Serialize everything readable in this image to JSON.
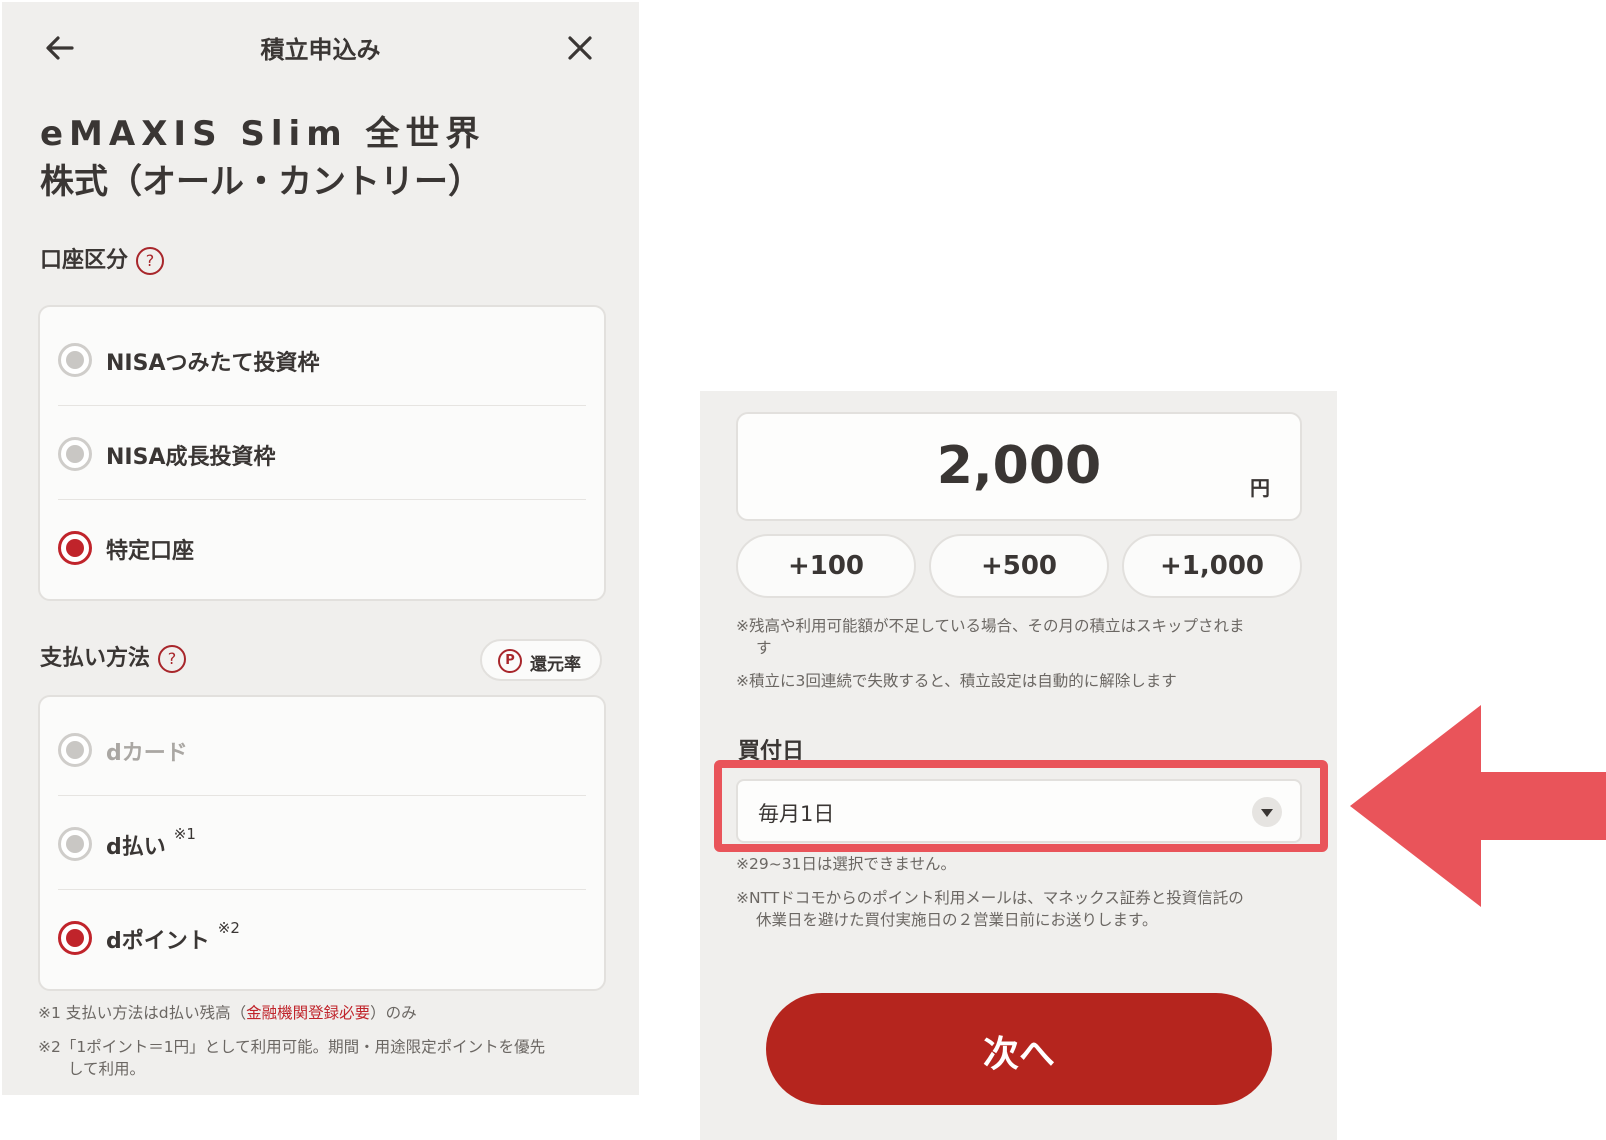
{
  "header": {
    "title": "積立申込み"
  },
  "fund": {
    "name_line1": "eMAXIS Slim 全世界",
    "name_line2": "株式（オール・カントリー）"
  },
  "account": {
    "label": "口座区分",
    "help": "?",
    "options": [
      {
        "label": "NISAつみたて投資枠",
        "selected": false
      },
      {
        "label": "NISA成長投資枠",
        "selected": false
      },
      {
        "label": "特定口座",
        "selected": true
      }
    ]
  },
  "payment": {
    "label": "支払い方法",
    "help": "?",
    "rate_badge": {
      "icon_text": "P",
      "label": "還元率"
    },
    "options": [
      {
        "label": "dカード",
        "note": "",
        "selected": false,
        "disabled": true
      },
      {
        "label": "d払い",
        "note": "※1",
        "selected": false,
        "disabled": false
      },
      {
        "label": "dポイント",
        "note": "※2",
        "selected": true,
        "disabled": false
      }
    ],
    "footnote1_prefix": "※1 支払い方法はd払い残高（",
    "footnote1_link": "金融機関登録必要",
    "footnote1_suffix": "）のみ",
    "footnote2_line1": "※2「1ポイント＝1円」として利用可能。期間・用途限定ポイントを優先",
    "footnote2_line2": "して利用。"
  },
  "amount": {
    "value": "2,000",
    "unit": "円",
    "increments": [
      "+100",
      "+500",
      "+1,000"
    ],
    "note1_line1": "※残高や利用可能額が不足している場合、その月の積立はスキップされま",
    "note1_line2": "す",
    "note2": "※積立に3回連続で失敗すると、積立設定は自動的に解除します"
  },
  "purchase_date": {
    "label": "買付日",
    "selected": "毎月1日",
    "note1": "※29~31日は選択できません。",
    "note2_line1": "※NTTドコモからのポイント利用メールは、マネックス証券と投資信託の",
    "note2_line2": "休業日を避けた買付実施日の２営業日前にお送りします。"
  },
  "next_button": {
    "label": "次へ"
  },
  "colors": {
    "accent": "#c0242b",
    "highlight": "#e9545a",
    "button": "#b5251e",
    "panel_bg": "#f0efed"
  },
  "icons": {
    "back": "arrow-left-icon",
    "close": "close-icon",
    "dropdown": "chevron-down-icon",
    "pointer": "arrow-left-pointer"
  }
}
